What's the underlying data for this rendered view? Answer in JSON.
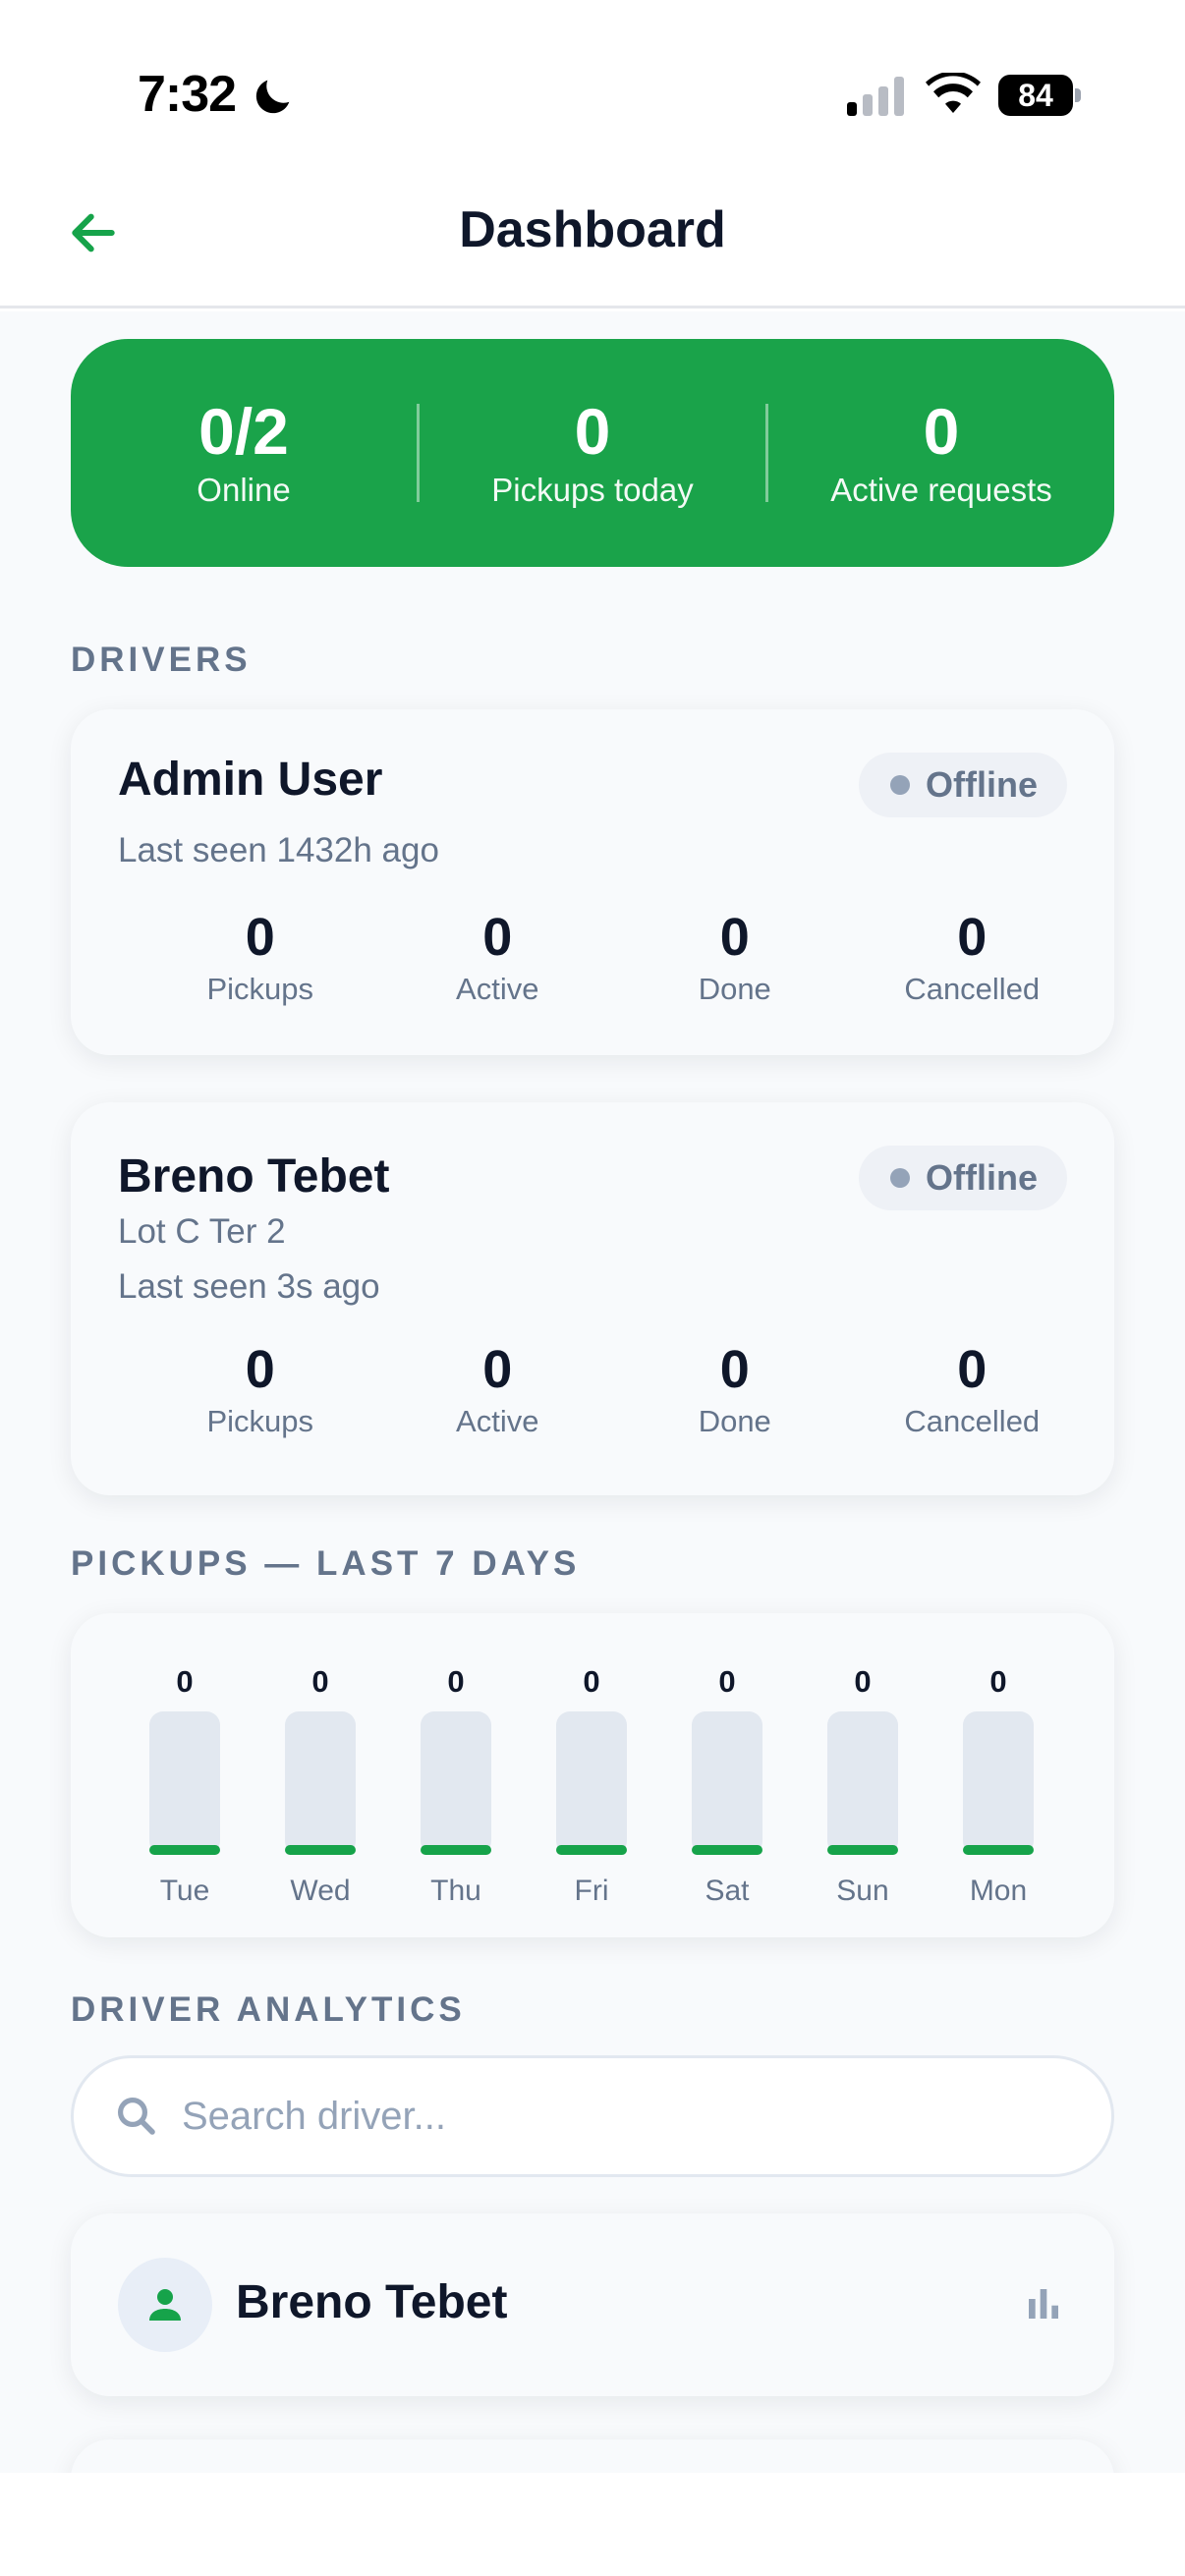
{
  "status_bar": {
    "time": "7:32",
    "battery": "84"
  },
  "header": {
    "title": "Dashboard"
  },
  "summary": [
    {
      "value": "0/2",
      "label": "Online"
    },
    {
      "value": "0",
      "label": "Pickups today"
    },
    {
      "value": "0",
      "label": "Active requests"
    }
  ],
  "sections": {
    "drivers": "DRIVERS",
    "pickups_chart": "PICKUPS — LAST 7 DAYS",
    "driver_analytics": "DRIVER ANALYTICS"
  },
  "drivers": [
    {
      "name": "Admin User",
      "lines": [
        "Last seen 1432h ago"
      ],
      "status": "Offline",
      "metrics": [
        {
          "value": "0",
          "label": "Pickups"
        },
        {
          "value": "0",
          "label": "Active"
        },
        {
          "value": "0",
          "label": "Done"
        },
        {
          "value": "0",
          "label": "Cancelled"
        }
      ]
    },
    {
      "name": "Breno Tebet",
      "lines": [
        "Lot C Ter 2",
        "Last seen 3s ago"
      ],
      "status": "Offline",
      "metrics": [
        {
          "value": "0",
          "label": "Pickups"
        },
        {
          "value": "0",
          "label": "Active"
        },
        {
          "value": "0",
          "label": "Done"
        },
        {
          "value": "0",
          "label": "Cancelled"
        }
      ]
    }
  ],
  "chart_data": {
    "type": "bar",
    "categories": [
      "Tue",
      "Wed",
      "Thu",
      "Fri",
      "Sat",
      "Sun",
      "Mon"
    ],
    "values": [
      0,
      0,
      0,
      0,
      0,
      0,
      0
    ],
    "title": "PICKUPS — LAST 7 DAYS",
    "bar_color": "#16a34a",
    "track_color": "#e2e8f0"
  },
  "search": {
    "placeholder": "Search driver...",
    "value": ""
  },
  "analytics_list": [
    {
      "name": "Breno Tebet"
    }
  ],
  "colors": {
    "brand_green": "#1aa34a",
    "muted_text": "#64748b",
    "offline_dot": "#94a3b8"
  }
}
